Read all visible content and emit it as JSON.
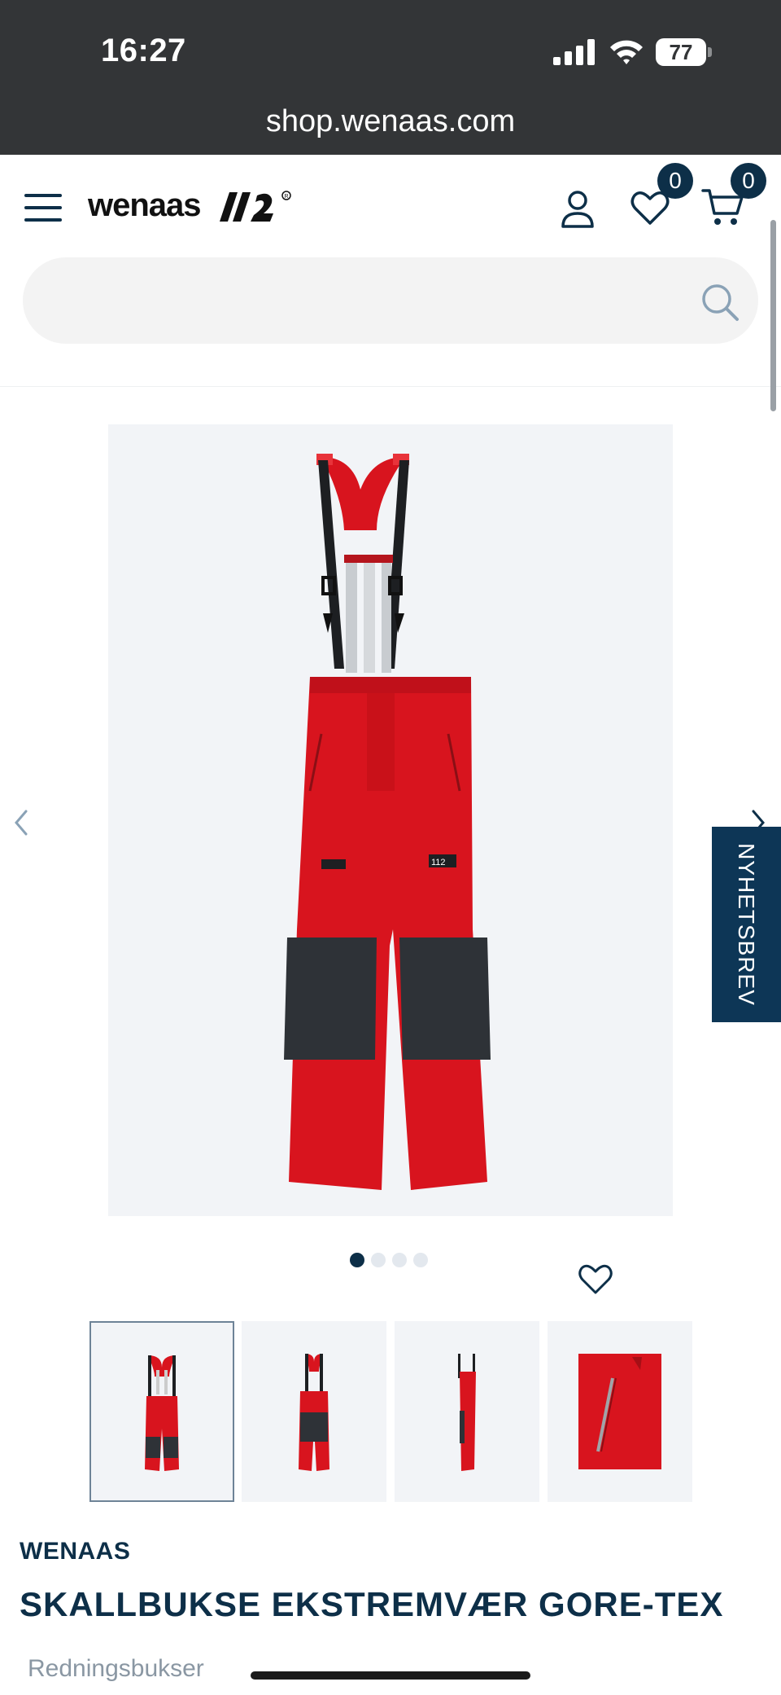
{
  "status_bar": {
    "time": "16:27",
    "battery": "77"
  },
  "browser": {
    "url": "shop.wenaas.com"
  },
  "header": {
    "logo_text": "wenaas",
    "wishlist_count": "0",
    "cart_count": "0",
    "search_placeholder": ""
  },
  "newsletter": {
    "label": "NYHETSBREV"
  },
  "gallery": {
    "image_count": 4,
    "active_index": 0,
    "thumbnails": [
      "front-view",
      "front-view-dark-knees",
      "side-view",
      "detail-zip"
    ]
  },
  "product": {
    "brand": "WENAAS",
    "title": "SKALLBUKSE EKSTREMVÆR GORE-TEX",
    "category": "Redningsbukser",
    "badge_text": "112",
    "colors": {
      "main": "#d8141e",
      "knee_patch": "#2e3237",
      "accent": "#0d2f48"
    }
  }
}
